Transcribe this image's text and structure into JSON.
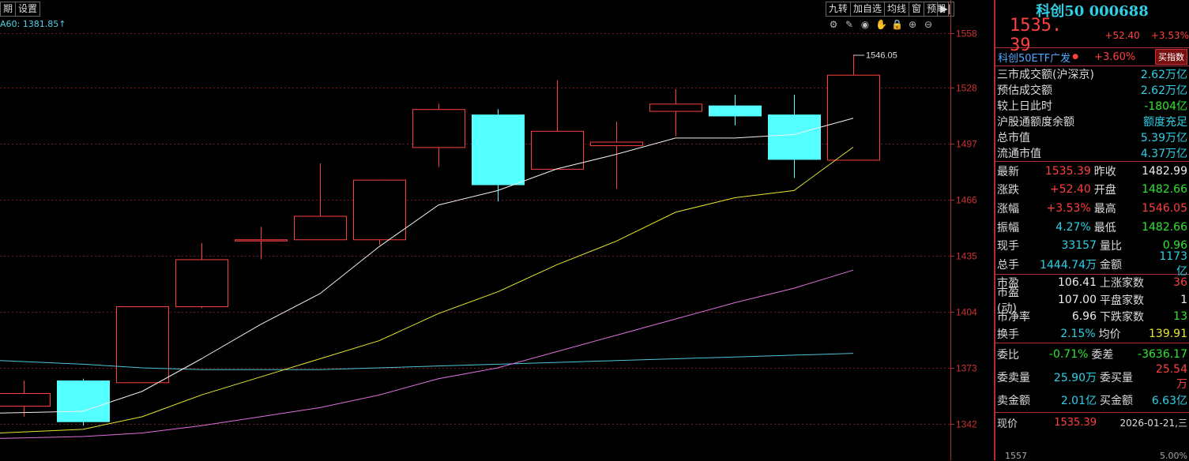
{
  "top_tabs": [
    "期",
    "设置"
  ],
  "tool_tabs": [
    "九转",
    "加自选",
    "均线",
    "窗",
    "预期"
  ],
  "tool_end": "▶|",
  "ma_label": "A60: 1381.85↑",
  "icons": [
    "gear-icon",
    "pen-icon",
    "eye-icon",
    "hand-icon",
    "lock-icon",
    "zoom-in-icon",
    "zoom-out-icon"
  ],
  "icon_glyphs": [
    "⚙",
    "✎",
    "◉",
    "✋",
    "🔒",
    "⊕",
    "⊖"
  ],
  "chart_data": {
    "type": "candlestick",
    "y_ticks": [
      1558,
      1528,
      1497,
      1466,
      1435,
      1404,
      1373,
      1342
    ],
    "ylim": [
      1333,
      1562
    ],
    "max_label": "1546.05",
    "candles": [
      {
        "o": 1352,
        "c": 1359,
        "h": 1366,
        "l": 1346,
        "dir": "up"
      },
      {
        "o": 1366,
        "c": 1343,
        "h": 1367,
        "l": 1341,
        "dir": "down"
      },
      {
        "o": 1365,
        "c": 1407,
        "h": 1407,
        "l": 1365,
        "dir": "up"
      },
      {
        "o": 1407,
        "c": 1433,
        "h": 1442,
        "l": 1406,
        "dir": "up"
      },
      {
        "o": 1444,
        "c": 1444,
        "h": 1451,
        "l": 1433,
        "dir": "up"
      },
      {
        "o": 1444,
        "c": 1457,
        "h": 1486,
        "l": 1444,
        "dir": "up"
      },
      {
        "o": 1444,
        "c": 1477,
        "h": 1477,
        "l": 1441,
        "dir": "up"
      },
      {
        "o": 1495,
        "c": 1516,
        "h": 1519,
        "l": 1484,
        "dir": "up"
      },
      {
        "o": 1513,
        "c": 1474,
        "h": 1516,
        "l": 1465,
        "dir": "down"
      },
      {
        "o": 1483,
        "c": 1504,
        "h": 1532,
        "l": 1483,
        "dir": "up"
      },
      {
        "o": 1496,
        "c": 1498,
        "h": 1509,
        "l": 1472,
        "dir": "up"
      },
      {
        "o": 1515,
        "c": 1519,
        "h": 1527,
        "l": 1501,
        "dir": "up"
      },
      {
        "o": 1518,
        "c": 1512,
        "h": 1524,
        "l": 1507,
        "dir": "down"
      },
      {
        "o": 1513,
        "c": 1488,
        "h": 1524,
        "l": 1478,
        "dir": "down"
      },
      {
        "o": 1488,
        "c": 1535,
        "h": 1546,
        "l": 1488,
        "dir": "up"
      }
    ],
    "ma_white": [
      1348,
      1349,
      1360,
      1378,
      1397,
      1414,
      1440,
      1463,
      1471,
      1483,
      1491,
      1500,
      1500,
      1502,
      1511
    ],
    "ma_yellow": [
      1337,
      1339,
      1346,
      1358,
      1368,
      1378,
      1388,
      1403,
      1415,
      1430,
      1443,
      1459,
      1467,
      1471,
      1495
    ],
    "ma_magenta": [
      1334,
      1335,
      1337,
      1341,
      1346,
      1351,
      1358,
      1367,
      1373,
      1382,
      1391,
      1400,
      1409,
      1417,
      1427
    ],
    "ma_cyan": [
      1377,
      1375,
      1373,
      1372,
      1372,
      1372,
      1373,
      1374,
      1375,
      1376,
      1377,
      1378,
      1379,
      1380,
      1381
    ]
  },
  "panel": {
    "title": "科创50 000688",
    "price": "1535. 39",
    "change": "+52.40",
    "pct": "+3.53%",
    "etf_name": "科创50ETF广发",
    "etf_dot": "●",
    "etf_pct": "+3.60%",
    "etf_btn": "买指数",
    "stats": [
      {
        "k": "三市成交额(沪深京)",
        "v": "2.62万亿",
        "c": "cyan"
      },
      {
        "k": "预估成交额",
        "v": "2.62万亿",
        "c": "cyan"
      },
      {
        "k": "较上日此时",
        "v": "-1804亿",
        "c": "green"
      },
      {
        "k": "沪股通额度余额",
        "v": "额度充足",
        "c": "cyan"
      },
      {
        "k": "总市值",
        "v": "5.39万亿",
        "c": "cyan"
      },
      {
        "k": "流通市值",
        "v": "4.37万亿",
        "c": "cyan"
      }
    ],
    "grid1": [
      {
        "l": "最新",
        "v1": "1535.39",
        "c1": "red",
        "l2": "昨收",
        "v2": "1482.99",
        "c2": "white"
      },
      {
        "l": "涨跌",
        "v1": "+52.40",
        "c1": "red",
        "l2": "开盘",
        "v2": "1482.66",
        "c2": "green"
      },
      {
        "l": "涨幅",
        "v1": "+3.53%",
        "c1": "red",
        "l2": "最高",
        "v2": "1546.05",
        "c2": "red"
      },
      {
        "l": "振幅",
        "v1": "4.27%",
        "c1": "cyan",
        "l2": "最低",
        "v2": "1482.66",
        "c2": "green"
      },
      {
        "l": "现手",
        "v1": "33157",
        "c1": "cyan",
        "l2": "量比",
        "v2": "0.96",
        "c2": "green"
      },
      {
        "l": "总手",
        "v1": "1444.74万",
        "c1": "cyan",
        "l2": "金额",
        "v2": "1173亿",
        "c2": "cyan"
      }
    ],
    "grid2": [
      {
        "l": "市盈",
        "v1": "106.41",
        "c1": "white",
        "l2": "上涨家数",
        "v2": "36",
        "c2": "red"
      },
      {
        "l": "市盈(动)",
        "v1": "107.00",
        "c1": "white",
        "l2": "平盘家数",
        "v2": "1",
        "c2": "white"
      },
      {
        "l": "市净率",
        "v1": "6.96",
        "c1": "white",
        "l2": "下跌家数",
        "v2": "13",
        "c2": "green"
      },
      {
        "l": "换手",
        "v1": "2.15%",
        "c1": "cyan",
        "l2": "均价",
        "v2": "139.91",
        "c2": "yellow"
      }
    ],
    "grid3": [
      {
        "l": "委比",
        "v1": "-0.71%",
        "c1": "green",
        "l2": "委差",
        "v2": "-3636.17",
        "c2": "green"
      },
      {
        "l": "委卖量",
        "v1": "25.90万",
        "c1": "cyan",
        "l2": "委买量",
        "v2": "25.54万",
        "c2": "red"
      },
      {
        "l": "卖金额",
        "v1": "2.01亿",
        "c1": "cyan",
        "l2": "买金额",
        "v2": "6.63亿",
        "c2": "cyan"
      }
    ],
    "now_label": "现价",
    "now_price": "1535.39",
    "date": "2026-01-21,三",
    "mini_left": "1557",
    "mini_right": "5.00%"
  }
}
